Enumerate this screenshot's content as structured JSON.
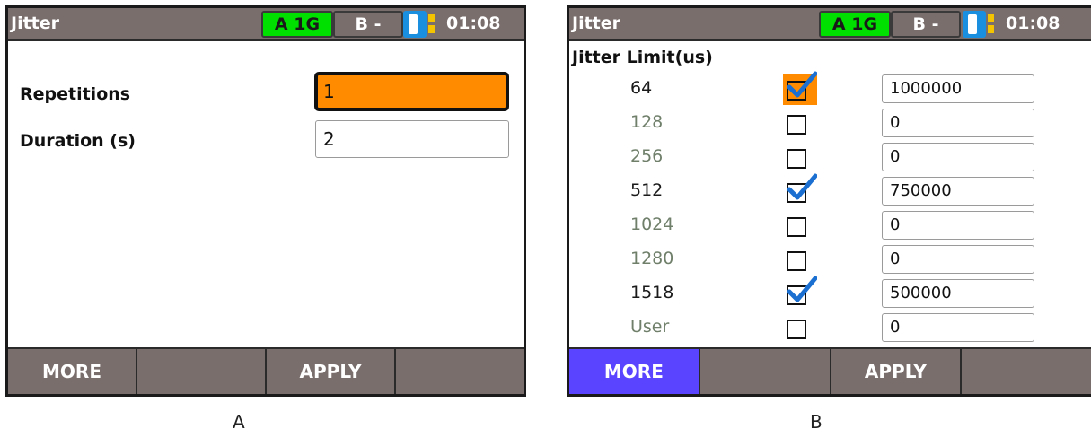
{
  "panels": [
    {
      "label": "A",
      "title": "Jitter",
      "status": {
        "port_a": "A 1G",
        "port_b": "B -",
        "time": "01:08"
      },
      "fields": [
        {
          "label": "Repetitions",
          "value": "1"
        },
        {
          "label": "Duration (s)",
          "value": "2"
        }
      ],
      "softkeys": [
        "MORE",
        "",
        "APPLY",
        ""
      ]
    },
    {
      "label": "B",
      "title": "Jitter",
      "status": {
        "port_a": "A 1G",
        "port_b": "B -",
        "time": "01:08"
      },
      "section_title": "Jitter Limit(us)",
      "rows": [
        {
          "size": "64",
          "checked": true,
          "value": "1000000"
        },
        {
          "size": "128",
          "checked": false,
          "value": "0"
        },
        {
          "size": "256",
          "checked": false,
          "value": "0"
        },
        {
          "size": "512",
          "checked": true,
          "value": "750000"
        },
        {
          "size": "1024",
          "checked": false,
          "value": "0"
        },
        {
          "size": "1280",
          "checked": false,
          "value": "0"
        },
        {
          "size": "1518",
          "checked": true,
          "value": "500000"
        },
        {
          "size": "User",
          "checked": false,
          "value": "0"
        }
      ],
      "softkeys": [
        "MORE",
        "",
        "APPLY",
        ""
      ]
    }
  ],
  "colors": {
    "titlebar": "#7a6e6c",
    "port_active": "#00e000",
    "focus": "#ff8c00",
    "softkey_active": "#5b44ff",
    "checkmark": "#1a6fd1",
    "port_icon_blue": "#1a8fe0",
    "port_icon_yellow": "#f5c400"
  },
  "icons": [
    "port-status-icon",
    "checkmark-icon"
  ]
}
